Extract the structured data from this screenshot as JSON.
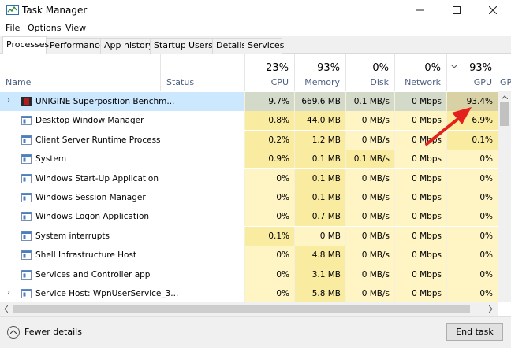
{
  "window": {
    "title": "Task Manager",
    "controls": [
      "minimize",
      "maximize",
      "close"
    ]
  },
  "menu": [
    "File",
    "Options",
    "View"
  ],
  "tabs": [
    "Processes",
    "Performance",
    "App history",
    "Startup",
    "Users",
    "Details",
    "Services"
  ],
  "active_tab": "Processes",
  "columns": {
    "name": "Name",
    "status": "Status",
    "cpu": {
      "pct": "23%",
      "label": "CPU"
    },
    "memory": {
      "pct": "93%",
      "label": "Memory"
    },
    "disk": {
      "pct": "0%",
      "label": "Disk"
    },
    "network": {
      "pct": "0%",
      "label": "Network"
    },
    "gpu": {
      "pct": "93%",
      "label": "GPU",
      "sorted": true
    },
    "gpu_engine_partial": "GP"
  },
  "processes": [
    {
      "name": "UNIGINE Superposition Benchm...",
      "expandable": true,
      "cpu": "9.7%",
      "memory": "669.6 MB",
      "disk": "0.1 MB/s",
      "network": "0 Mbps",
      "gpu": "93.4%",
      "selected": true
    },
    {
      "name": "Desktop Window Manager",
      "cpu": "0.8%",
      "memory": "44.0 MB",
      "disk": "0 MB/s",
      "network": "0 Mbps",
      "gpu": "6.9%"
    },
    {
      "name": "Client Server Runtime Process",
      "cpu": "0.2%",
      "memory": "1.2 MB",
      "disk": "0 MB/s",
      "network": "0 Mbps",
      "gpu": "0.1%"
    },
    {
      "name": "System",
      "cpu": "0.9%",
      "memory": "0.1 MB",
      "disk": "0.1 MB/s",
      "network": "0 Mbps",
      "gpu": "0%"
    },
    {
      "name": "Windows Start-Up Application",
      "cpu": "0%",
      "memory": "0.1 MB",
      "disk": "0 MB/s",
      "network": "0 Mbps",
      "gpu": "0%"
    },
    {
      "name": "Windows Session Manager",
      "cpu": "0%",
      "memory": "0.1 MB",
      "disk": "0 MB/s",
      "network": "0 Mbps",
      "gpu": "0%"
    },
    {
      "name": "Windows Logon Application",
      "cpu": "0%",
      "memory": "0.7 MB",
      "disk": "0 MB/s",
      "network": "0 Mbps",
      "gpu": "0%"
    },
    {
      "name": "System interrupts",
      "cpu": "0.1%",
      "memory": "0 MB",
      "disk": "0 MB/s",
      "network": "0 Mbps",
      "gpu": "0%"
    },
    {
      "name": "Shell Infrastructure Host",
      "cpu": "0%",
      "memory": "4.8 MB",
      "disk": "0 MB/s",
      "network": "0 Mbps",
      "gpu": "0%"
    },
    {
      "name": "Services and Controller app",
      "cpu": "0%",
      "memory": "3.1 MB",
      "disk": "0 MB/s",
      "network": "0 Mbps",
      "gpu": "0%"
    },
    {
      "name": "Service Host: WpnUserService_3...",
      "expandable": true,
      "cpu": "0%",
      "memory": "5.8 MB",
      "disk": "0 MB/s",
      "network": "0 Mbps",
      "gpu": "0%"
    }
  ],
  "footer": {
    "fewer_details": "Fewer details",
    "end_task": "End task"
  },
  "colors": {
    "selected_row": "#cce8ff",
    "heat_light": "#fff4c4",
    "heat_mid": "#f9eba0",
    "heat_high": "#d7d1a5",
    "annotation_arrow": "#e3201b"
  }
}
